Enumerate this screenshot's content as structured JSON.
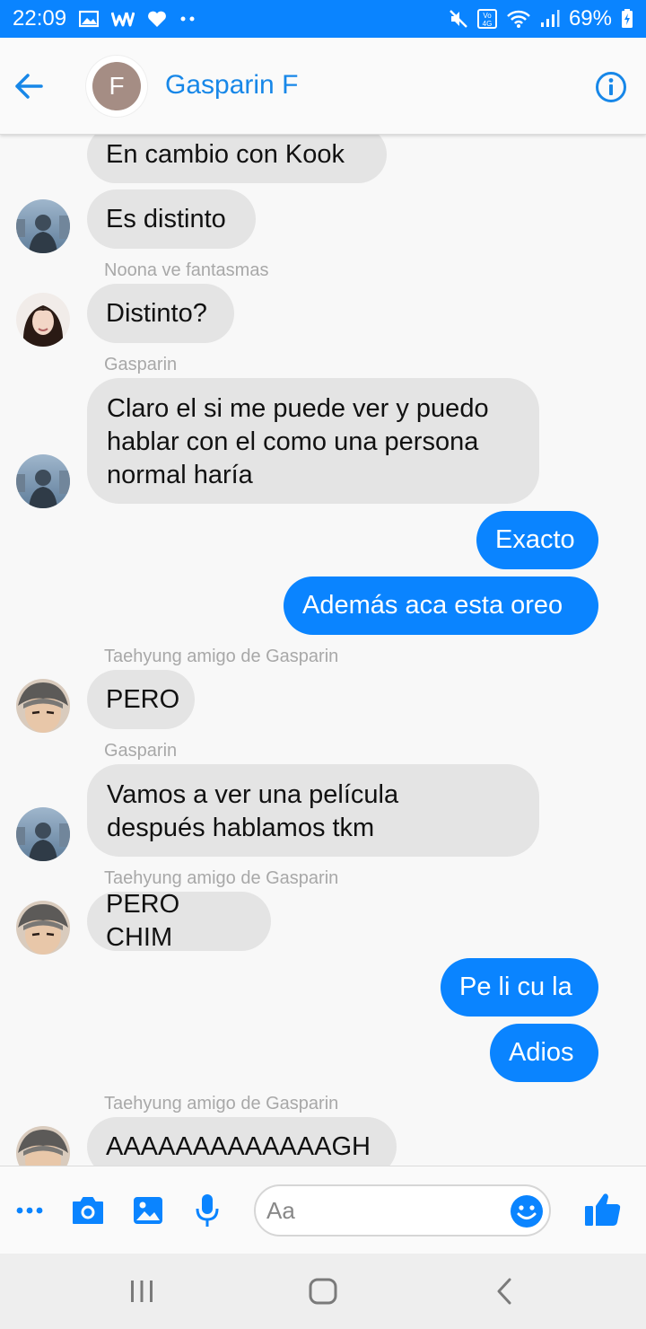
{
  "status_bar": {
    "time": "22:09",
    "battery": "69%"
  },
  "header": {
    "avatar_initial": "F",
    "title": "Gasparin F",
    "colors": {
      "accent": "#1787e8",
      "avatar_bg": "#a58d84"
    }
  },
  "messages": [
    {
      "direction": "in",
      "text": "En cambio con Kook"
    },
    {
      "direction": "in",
      "text": "Es distinto"
    },
    {
      "direction": "in",
      "sender": "Noona ve fantasmas",
      "text": "Distinto?"
    },
    {
      "direction": "in",
      "sender": "Gasparin",
      "lines": [
        "Claro el si me puede ver y puedo",
        "hablar con el como una persona",
        "normal haría"
      ]
    },
    {
      "direction": "out",
      "text": "Exacto"
    },
    {
      "direction": "out",
      "text": "Además aca esta oreo"
    },
    {
      "direction": "in",
      "sender": "Taehyung amigo de Gasparin",
      "text": "PERO"
    },
    {
      "direction": "in",
      "sender": "Gasparin",
      "lines": [
        "Vamos a ver una película",
        "después hablamos tkm"
      ]
    },
    {
      "direction": "in",
      "sender": "Taehyung amigo de Gasparin",
      "text": "PERO CHIM"
    },
    {
      "direction": "out",
      "text": "Pe li cu la"
    },
    {
      "direction": "out",
      "text": "Adios"
    },
    {
      "direction": "in",
      "sender": "Taehyung amigo de Gasparin",
      "text": "AAAAAAAAAAAAAGH"
    }
  ],
  "composer": {
    "placeholder": "Aa"
  },
  "icons": {
    "back": "arrow-left-icon",
    "info": "info-icon",
    "more": "more-icon",
    "camera": "camera-icon",
    "gallery": "image-icon",
    "mic": "microphone-icon",
    "emoji": "emoji-icon",
    "like": "thumbs-up-icon",
    "nav_recents": "recents-icon",
    "nav_home": "home-icon",
    "nav_back": "chevron-left-icon"
  },
  "colors": {
    "status_bar": "#0a84ff",
    "outgoing_bubble": "#0a84ff",
    "incoming_bubble": "#e4e4e4"
  }
}
